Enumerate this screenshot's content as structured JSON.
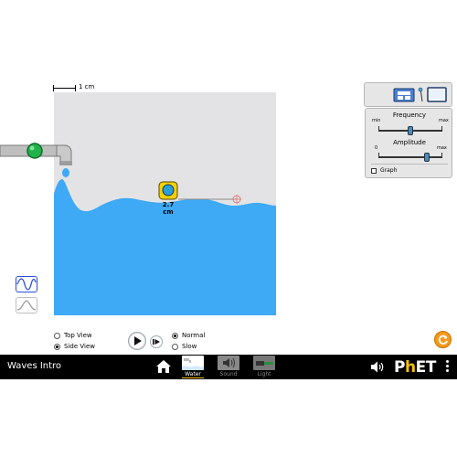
{
  "app": {
    "title": "Waves Intro"
  },
  "scale_bar": {
    "label": "1 cm"
  },
  "tape_measure": {
    "readout": "2.7 cm"
  },
  "view_options": {
    "top_view": "Top View",
    "side_view": "Side View",
    "selected": "Side View"
  },
  "speed_options": {
    "normal": "Normal",
    "slow": "Slow",
    "selected": "Normal"
  },
  "controls": {
    "frequency": {
      "title": "Frequency",
      "min": "min",
      "max": "max",
      "value": 0.5
    },
    "amplitude": {
      "title": "Amplitude",
      "min": "0",
      "max": "max",
      "value": 0.75
    },
    "graph_label": "Graph",
    "graph_checked": false
  },
  "navbar": {
    "screens": [
      {
        "label": "Water",
        "selected": true
      },
      {
        "label": "Sound",
        "selected": false
      },
      {
        "label": "Light",
        "selected": false
      }
    ],
    "logo": {
      "p": "P",
      "h": "h",
      "et": "ET"
    }
  },
  "colors": {
    "water": "#3ea9f5",
    "tank_background": "#e3e3e5",
    "faucet_button": "#22b24c",
    "reset_button": "#f39a1e",
    "navbar": "#000000",
    "selected_screen_underline": "#f5c400"
  },
  "icons": {
    "home": "home-icon",
    "sound": "speaker-icon",
    "reset": "reset-icon",
    "menu": "kebab-menu-icon",
    "play": "play-icon",
    "step": "step-forward-icon"
  }
}
